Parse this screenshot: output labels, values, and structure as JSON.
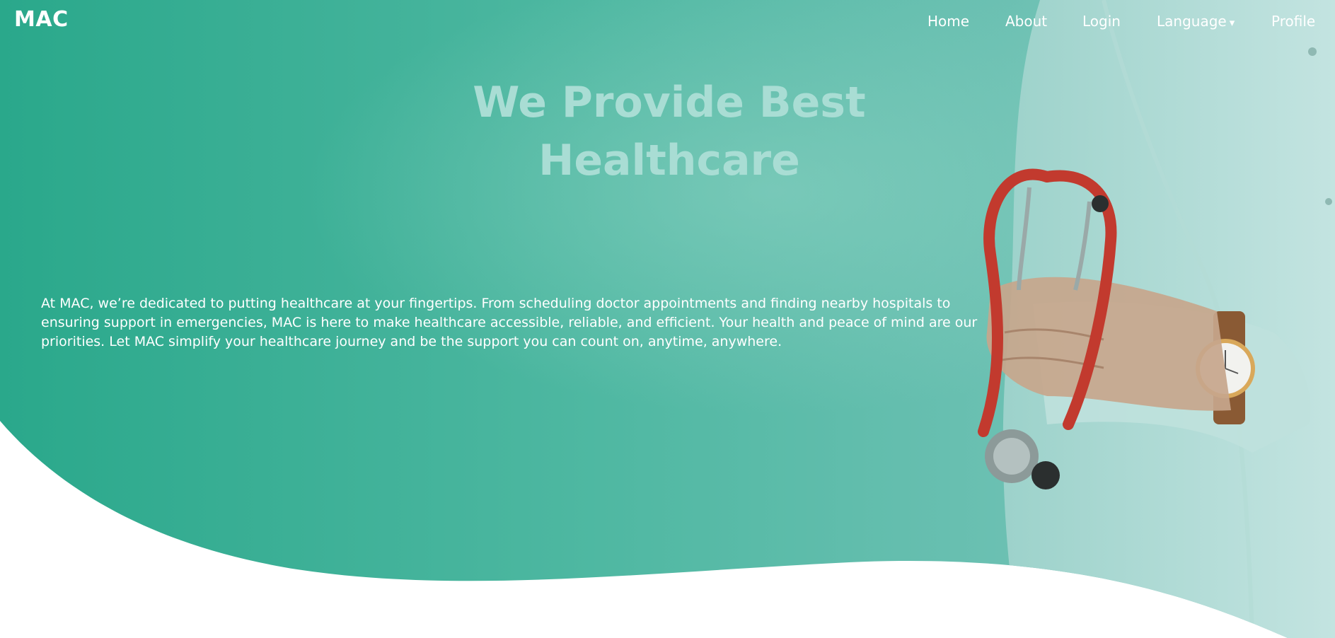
{
  "brand": {
    "logo_text": "MAC"
  },
  "nav": {
    "home": "Home",
    "about": "About",
    "login": "Login",
    "language": "Language",
    "language_caret": "▾",
    "profile": "Profile"
  },
  "hero": {
    "title_line1": "We Provide Best",
    "title_line2": "Healthcare",
    "description": "At MAC, we’re dedicated to putting healthcare at your fingertips. From scheduling doctor appointments and finding nearby hospitals to ensuring support in emergencies, MAC is here to make healthcare accessible, reliable, and efficient. Your health and peace of mind are our priorities. Let MAC simplify your healthcare journey and be the support you can count on, anytime, anywhere."
  },
  "colors": {
    "teal_primary": "#2fa98c",
    "teal_light": "#8fd0c4",
    "title_color": "#a9ddd4",
    "background": "#ffffff",
    "stethoscope_red": "#c23a2e"
  },
  "icons": {
    "language_dropdown": "chevron-down-icon"
  }
}
